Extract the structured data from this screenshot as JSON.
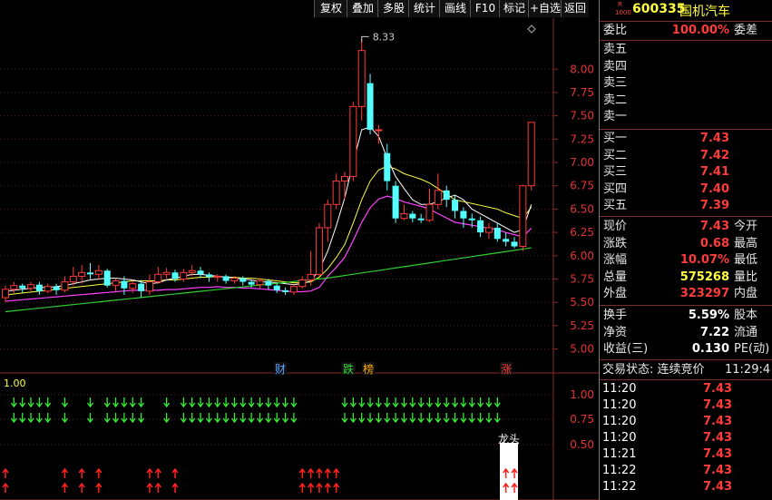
{
  "toolbar": {
    "buttons": [
      "复权",
      "叠加",
      "多股",
      "统计",
      "画线",
      "F10",
      "标记",
      "+自选",
      "返回"
    ]
  },
  "stock": {
    "badge_top": "R",
    "badge_bottom": "1000",
    "code": "600335",
    "name": "国机汽车"
  },
  "quote": {
    "weibi_label": "委比",
    "weibi_value": "100.00%",
    "weicha_label": "委差",
    "sell": [
      {
        "label": "卖五",
        "price": ""
      },
      {
        "label": "卖四",
        "price": ""
      },
      {
        "label": "卖三",
        "price": ""
      },
      {
        "label": "卖二",
        "price": ""
      },
      {
        "label": "卖一",
        "price": ""
      }
    ],
    "buy": [
      {
        "label": "买一",
        "price": "7.43"
      },
      {
        "label": "买二",
        "price": "7.42"
      },
      {
        "label": "买三",
        "price": "7.41"
      },
      {
        "label": "买四",
        "price": "7.40"
      },
      {
        "label": "买五",
        "price": "7.39"
      }
    ],
    "stats": [
      {
        "label": "现价",
        "value": "7.43",
        "color": "red",
        "label2": "今开"
      },
      {
        "label": "涨跌",
        "value": "0.68",
        "color": "red",
        "label2": "最高"
      },
      {
        "label": "涨幅",
        "value": "10.07%",
        "color": "red",
        "label2": "最低"
      },
      {
        "label": "总量",
        "value": "575268",
        "color": "yellow",
        "label2": "量比"
      },
      {
        "label": "外盘",
        "value": "323297",
        "color": "red",
        "label2": "内盘"
      }
    ],
    "stats2": [
      {
        "label": "换手",
        "value": "5.59%",
        "color": "white",
        "label2": "股本"
      },
      {
        "label": "净资",
        "value": "7.22",
        "color": "white",
        "label2": "流通"
      },
      {
        "label": "收益(三)",
        "value": "0.130",
        "color": "white",
        "label2": "PE(动)"
      }
    ],
    "trade_status": "交易状态: 连续竞价",
    "trade_time": "11:29:4",
    "ticks": [
      {
        "time": "11:20",
        "price": "7.43"
      },
      {
        "time": "11:20",
        "price": "7.43"
      },
      {
        "time": "11:20",
        "price": "7.43"
      },
      {
        "time": "11:20",
        "price": "7.43"
      },
      {
        "time": "11:21",
        "price": "7.43"
      },
      {
        "time": "11:22",
        "price": "7.43"
      },
      {
        "time": "11:22",
        "price": "7.43"
      }
    ]
  },
  "main_chart": {
    "price_axis": [
      "8.00",
      "7.75",
      "7.50",
      "7.25",
      "7.00",
      "6.75",
      "6.50",
      "6.25",
      "6.00",
      "5.75",
      "5.50",
      "5.25",
      "5.00"
    ],
    "high_marker": "8.33",
    "event_tags": [
      {
        "text": "财",
        "color": "#5aa0ff"
      },
      {
        "text": "跌",
        "color": "#33dd33"
      },
      {
        "text": "榜",
        "color": "#ffaa00"
      },
      {
        "text": "涨",
        "color": "#ff3b3b"
      }
    ],
    "colors": {
      "up": "#ff3b3b",
      "down": "#54ffff",
      "ma5": "#ffffff",
      "ma10": "#ffff40",
      "ma20": "#ff40ff",
      "ma60": "#33cc33"
    }
  },
  "sub_chart": {
    "value_label": "1.00",
    "axis": [
      "1.00",
      "0.75",
      "0.50"
    ],
    "tag": "龙头"
  },
  "chart_data": {
    "type": "candlestick",
    "high_label": "8.33",
    "ylim": [
      4.85,
      8.45
    ],
    "candles": [
      [
        5.55,
        5.64,
        5.5,
        5.68
      ],
      [
        5.64,
        5.68,
        5.6,
        5.72
      ],
      [
        5.68,
        5.65,
        5.6,
        5.7
      ],
      [
        5.65,
        5.69,
        5.62,
        5.72
      ],
      [
        5.69,
        5.62,
        5.58,
        5.72
      ],
      [
        5.62,
        5.67,
        5.6,
        5.7
      ],
      [
        5.67,
        5.63,
        5.58,
        5.7
      ],
      [
        5.63,
        5.72,
        5.61,
        5.78
      ],
      [
        5.72,
        5.78,
        5.68,
        5.88
      ],
      [
        5.78,
        5.82,
        5.7,
        5.9
      ],
      [
        5.82,
        5.8,
        5.75,
        5.92
      ],
      [
        5.8,
        5.84,
        5.74,
        5.9
      ],
      [
        5.84,
        5.68,
        5.66,
        5.86
      ],
      [
        5.68,
        5.73,
        5.62,
        5.76
      ],
      [
        5.73,
        5.65,
        5.58,
        5.78
      ],
      [
        5.65,
        5.7,
        5.6,
        5.74
      ],
      [
        5.7,
        5.62,
        5.55,
        5.74
      ],
      [
        5.62,
        5.72,
        5.58,
        5.8
      ],
      [
        5.72,
        5.8,
        5.7,
        5.88
      ],
      [
        5.8,
        5.82,
        5.75,
        5.87
      ],
      [
        5.82,
        5.75,
        5.72,
        5.85
      ],
      [
        5.75,
        5.82,
        5.72,
        5.86
      ],
      [
        5.82,
        5.84,
        5.78,
        5.9
      ],
      [
        5.84,
        5.8,
        5.76,
        5.88
      ],
      [
        5.8,
        5.77,
        5.72,
        5.82
      ],
      [
        5.77,
        5.78,
        5.72,
        5.8
      ],
      [
        5.78,
        5.73,
        5.7,
        5.8
      ],
      [
        5.73,
        5.76,
        5.7,
        5.78
      ],
      [
        5.76,
        5.72,
        5.68,
        5.78
      ],
      [
        5.72,
        5.69,
        5.66,
        5.74
      ],
      [
        5.69,
        5.73,
        5.65,
        5.76
      ],
      [
        5.73,
        5.68,
        5.64,
        5.75
      ],
      [
        5.68,
        5.63,
        5.6,
        5.7
      ],
      [
        5.63,
        5.61,
        5.58,
        5.66
      ],
      [
        5.61,
        5.67,
        5.58,
        5.7
      ],
      [
        5.67,
        5.74,
        5.65,
        5.78
      ],
      [
        5.74,
        5.8,
        5.68,
        6.05
      ],
      [
        5.8,
        6.3,
        5.78,
        6.35
      ],
      [
        6.3,
        6.55,
        6.15,
        6.6
      ],
      [
        6.55,
        6.8,
        6.5,
        6.88
      ],
      [
        6.8,
        6.85,
        6.6,
        6.9
      ],
      [
        6.85,
        7.6,
        6.8,
        7.65
      ],
      [
        7.6,
        8.2,
        7.45,
        8.33
      ],
      [
        7.85,
        7.35,
        7.3,
        7.95
      ],
      [
        7.35,
        7.35,
        7.2,
        7.4
      ],
      [
        7.1,
        6.8,
        6.7,
        7.2
      ],
      [
        6.75,
        6.4,
        6.35,
        6.8
      ],
      [
        6.4,
        6.45,
        6.38,
        6.55
      ],
      [
        6.45,
        6.4,
        6.36,
        6.48
      ],
      [
        6.4,
        6.38,
        6.35,
        6.45
      ],
      [
        6.38,
        6.55,
        6.36,
        6.72
      ],
      [
        6.55,
        6.7,
        6.5,
        6.88
      ],
      [
        6.7,
        6.6,
        6.52,
        6.75
      ],
      [
        6.6,
        6.48,
        6.4,
        6.65
      ],
      [
        6.48,
        6.4,
        6.3,
        6.52
      ],
      [
        6.4,
        6.38,
        6.3,
        6.45
      ],
      [
        6.38,
        6.25,
        6.2,
        6.42
      ],
      [
        6.25,
        6.3,
        6.18,
        6.35
      ],
      [
        6.3,
        6.18,
        6.15,
        6.35
      ],
      [
        6.18,
        6.15,
        6.1,
        6.25
      ],
      [
        6.15,
        6.1,
        6.08,
        6.2
      ],
      [
        6.1,
        6.75,
        6.05,
        6.76
      ],
      [
        6.75,
        7.43,
        6.7,
        7.43
      ]
    ],
    "ma5": [
      5.62,
      5.63,
      5.64,
      5.65,
      5.66,
      5.66,
      5.67,
      5.68,
      5.7,
      5.72,
      5.74,
      5.75,
      5.76,
      5.76,
      5.75,
      5.74,
      5.72,
      5.7,
      5.71,
      5.74,
      5.76,
      5.78,
      5.8,
      5.8,
      5.79,
      5.78,
      5.77,
      5.76,
      5.75,
      5.74,
      5.72,
      5.72,
      5.71,
      5.7,
      5.69,
      5.7,
      5.73,
      5.85,
      6.05,
      6.32,
      6.62,
      7.0,
      7.35,
      7.38,
      7.28,
      7.05,
      6.85,
      6.72,
      6.6,
      6.55,
      6.55,
      6.58,
      6.62,
      6.65,
      6.6,
      6.5,
      6.45,
      6.4,
      6.35,
      6.3,
      6.25,
      6.28,
      6.55
    ],
    "ma10": [
      5.58,
      5.59,
      5.6,
      5.61,
      5.62,
      5.63,
      5.64,
      5.65,
      5.66,
      5.67,
      5.68,
      5.69,
      5.7,
      5.71,
      5.72,
      5.73,
      5.73,
      5.73,
      5.73,
      5.74,
      5.74,
      5.75,
      5.76,
      5.77,
      5.77,
      5.78,
      5.77,
      5.77,
      5.76,
      5.76,
      5.75,
      5.74,
      5.73,
      5.72,
      5.71,
      5.71,
      5.72,
      5.77,
      5.86,
      5.98,
      6.12,
      6.35,
      6.6,
      6.8,
      6.92,
      6.96,
      6.93,
      6.88,
      6.85,
      6.82,
      6.78,
      6.72,
      6.66,
      6.6,
      6.58,
      6.56,
      6.54,
      6.52,
      6.5,
      6.46,
      6.43,
      6.4,
      6.52
    ]
  }
}
